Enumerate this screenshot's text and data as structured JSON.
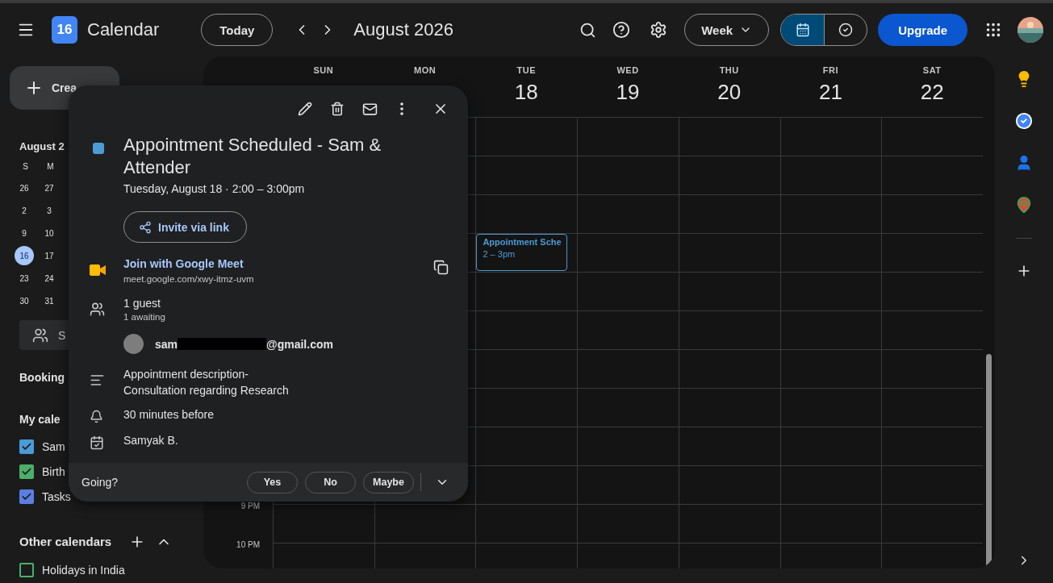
{
  "header": {
    "logo_day": "16",
    "app_name": "Calendar",
    "today_button": "Today",
    "period_title": "August 2026",
    "view_select": "Week",
    "views": [
      {
        "kind": "calendar",
        "selected": true
      },
      {
        "kind": "tasks",
        "selected": false
      }
    ],
    "upgrade_button": "Upgrade"
  },
  "sidebar": {
    "create_button": "Crea",
    "mini_calendar": {
      "title": "August 2",
      "weekdays": [
        "S",
        "M"
      ],
      "weeks": [
        [
          {
            "day": "26",
            "selected": false
          },
          {
            "day": "27",
            "selected": false
          }
        ],
        [
          {
            "day": "2",
            "selected": false
          },
          {
            "day": "3",
            "selected": false
          }
        ],
        [
          {
            "day": "9",
            "selected": false
          },
          {
            "day": "10",
            "selected": false
          }
        ],
        [
          {
            "day": "16",
            "selected": true
          },
          {
            "day": "17",
            "selected": false
          }
        ],
        [
          {
            "day": "23",
            "selected": false
          },
          {
            "day": "24",
            "selected": false
          }
        ],
        [
          {
            "day": "30",
            "selected": false
          },
          {
            "day": "31",
            "selected": false
          }
        ]
      ]
    },
    "search_people": "S",
    "booking_pages": "Booking",
    "my_calendars": {
      "title": "My cale",
      "items": [
        {
          "label": "Sam",
          "checked": true,
          "color": "#4a9bd6"
        },
        {
          "label": "Birth",
          "checked": true,
          "color": "#4caf69"
        },
        {
          "label": "Tasks",
          "checked": true,
          "color": "#5b7fe0"
        }
      ]
    },
    "other_calendars": {
      "title": "Other calendars",
      "items": [
        {
          "label": "Holidays in India",
          "checked": false,
          "color": "#4caf69"
        }
      ]
    }
  },
  "week_view": {
    "days": [
      {
        "weekday": "SUN"
      },
      {
        "weekday": "MON"
      },
      {
        "weekday": "TUE",
        "date": "18",
        "events": [
          {
            "title": "Appointment Sche",
            "time": "2 – 3pm",
            "color": "#4a9bd6"
          }
        ]
      },
      {
        "weekday": "WED",
        "date": "19"
      },
      {
        "weekday": "THU",
        "date": "20"
      },
      {
        "weekday": "FRI",
        "date": "21"
      },
      {
        "weekday": "SAT",
        "date": "22"
      }
    ],
    "time_labels": [
      "9 PM",
      "10 PM"
    ]
  },
  "event_popup": {
    "color": "#4a9bd6",
    "title": "Appointment Scheduled - Sam & Attender",
    "date": "Tuesday, August 18",
    "separator": "·",
    "time": "2:00 – 3:00pm",
    "invite_button": "Invite via link",
    "meet": {
      "link": "Join with Google Meet",
      "url": "meet.google.com/xwy-itmz-uvm"
    },
    "guests": {
      "summary": "1 guest",
      "status": "1 awaiting",
      "list": [
        {
          "email_start": "sam",
          "email_end": "@gmail.com"
        }
      ]
    },
    "description": "Appointment description-\nConsultation regarding Research",
    "reminder": "30 minutes before",
    "organizer": "Samyak B.",
    "rsvp": {
      "question": "Going?",
      "options": [
        {
          "label": "Yes",
          "selected": false
        },
        {
          "label": "No",
          "selected": false
        },
        {
          "label": "Maybe",
          "selected": false
        }
      ]
    }
  }
}
